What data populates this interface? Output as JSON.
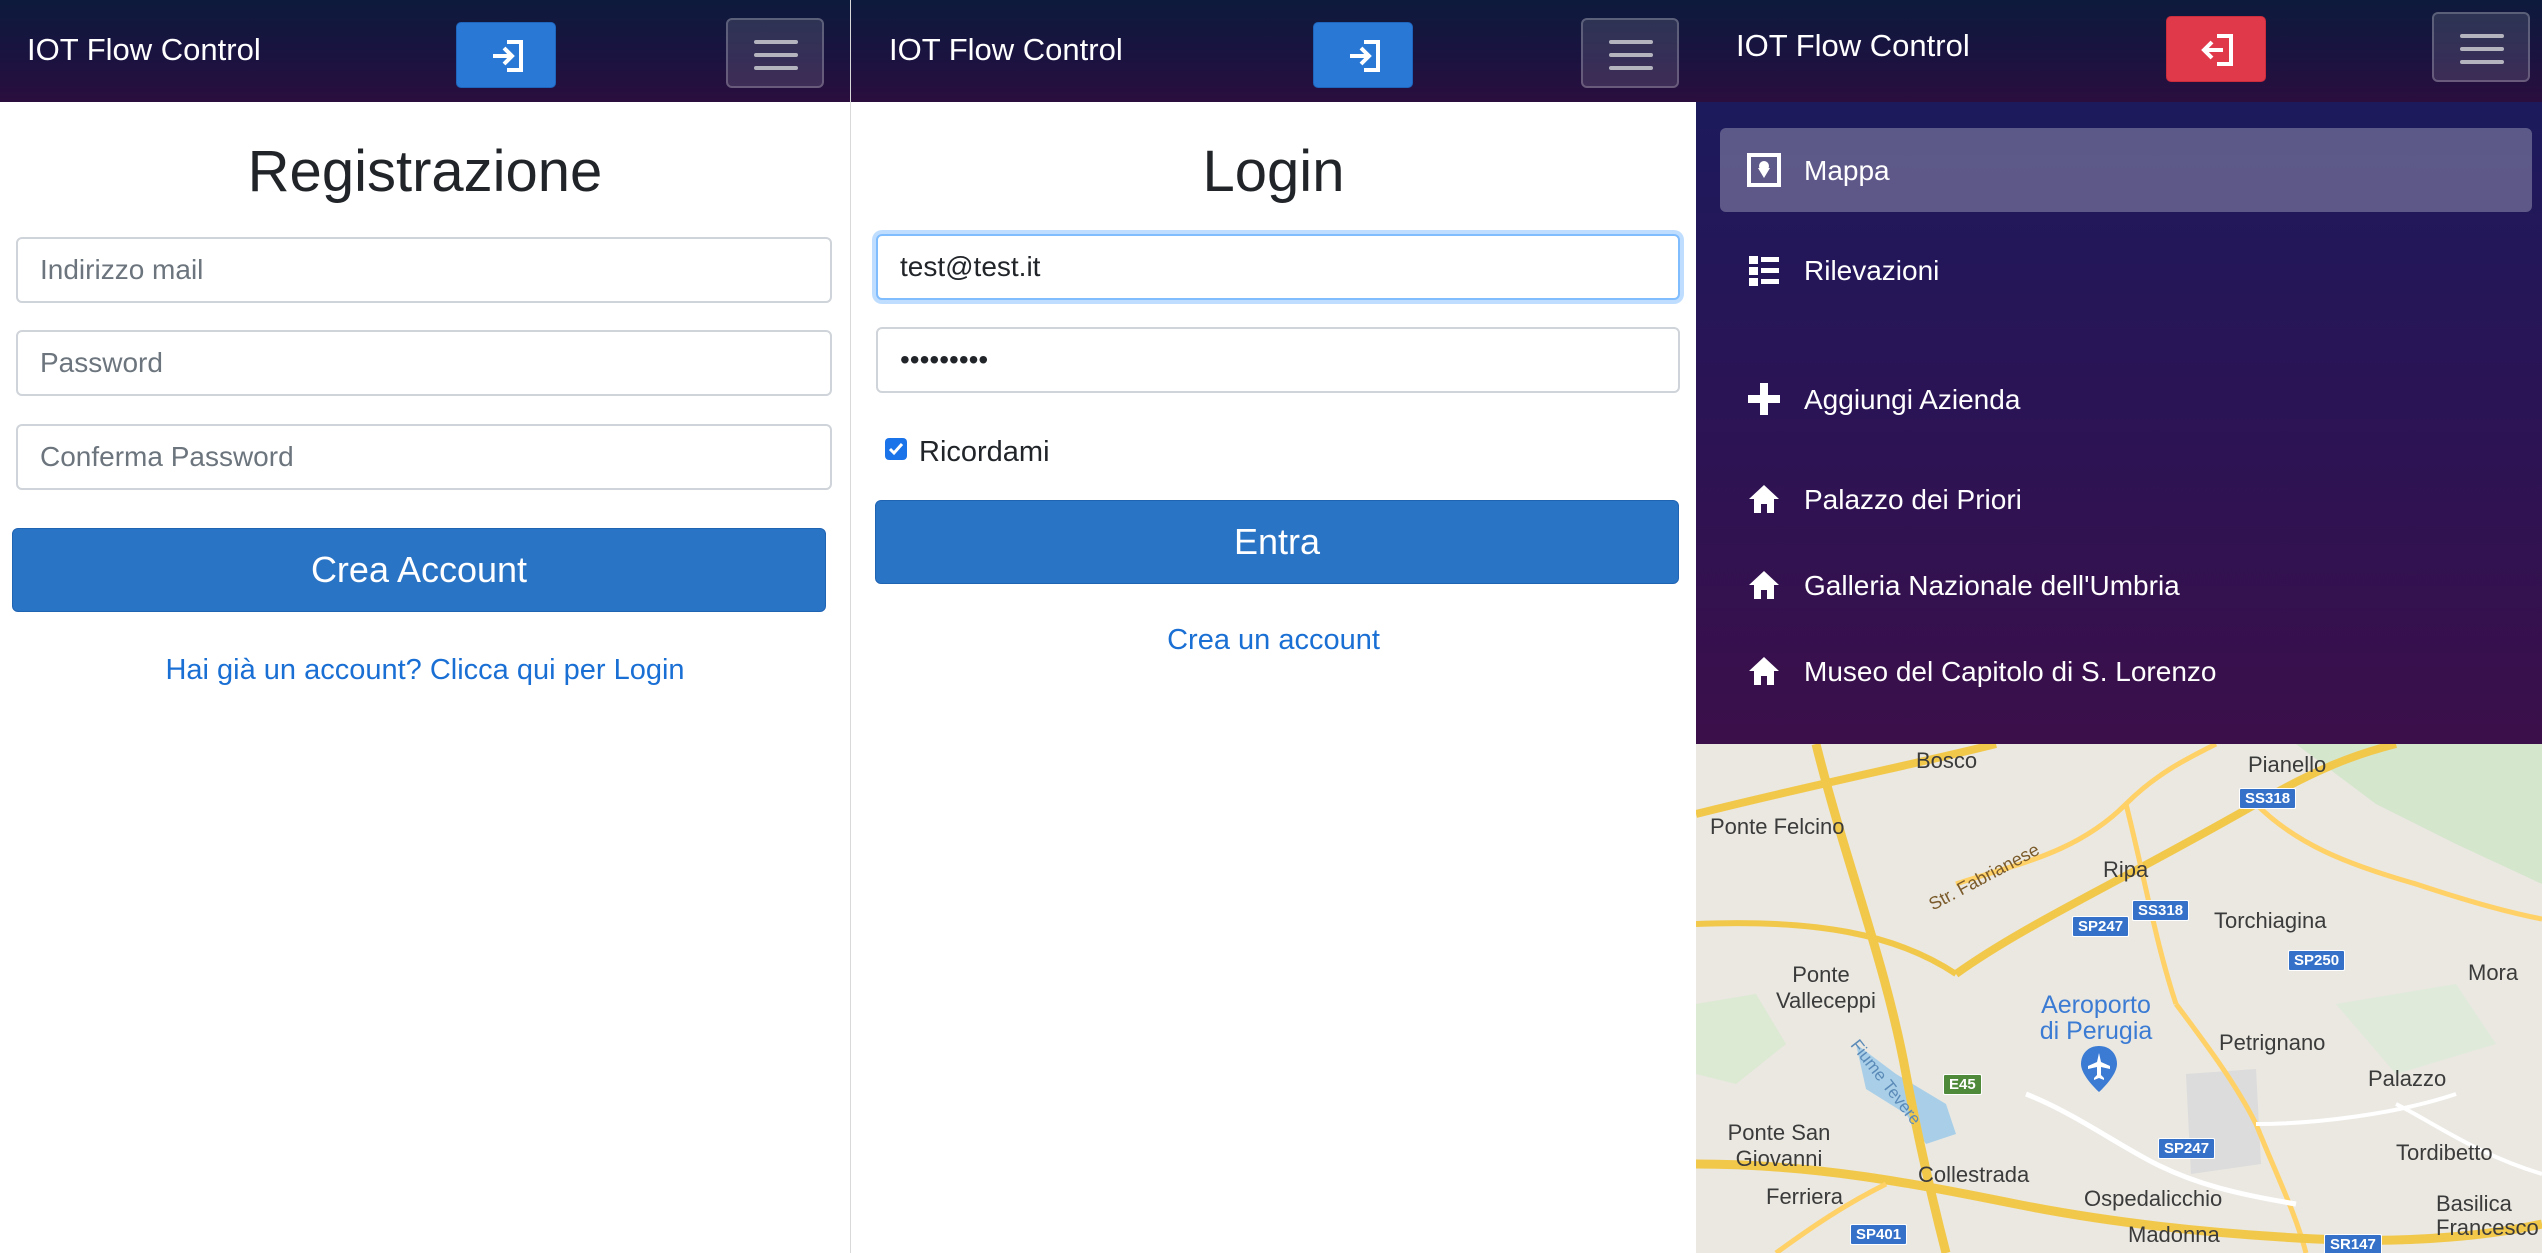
{
  "app": {
    "brand": "IOT Flow Control"
  },
  "colors": {
    "primary": "#2a74c6",
    "danger": "#e03a4a",
    "navbar": "#1a1340",
    "link": "#1a6fd4",
    "map_water": "#a9cfe8"
  },
  "registration": {
    "title": "Registrazione",
    "email_placeholder": "Indirizzo mail",
    "password_placeholder": "Password",
    "confirm_placeholder": "Conferma Password",
    "submit_label": "Crea Account",
    "login_link": "Hai già un account? Clicca qui per Login"
  },
  "login": {
    "title": "Login",
    "email_value": "test@test.it",
    "password_value": "123456789",
    "remember_label": "Ricordami",
    "remember_checked": true,
    "submit_label": "Entra",
    "register_link": "Crea un account"
  },
  "menu": {
    "items": [
      {
        "label": "Mappa",
        "icon": "map-icon",
        "active": true
      },
      {
        "label": "Rilevazioni",
        "icon": "list-icon",
        "active": false
      },
      {
        "label": "Aggiungi Azienda",
        "icon": "plus-icon",
        "active": false
      },
      {
        "label": "Palazzo dei Priori",
        "icon": "home-icon",
        "active": false
      },
      {
        "label": "Galleria Nazionale dell'Umbria",
        "icon": "home-icon",
        "active": false
      },
      {
        "label": "Museo del Capitolo di S. Lorenzo",
        "icon": "home-icon",
        "active": false
      }
    ]
  },
  "map": {
    "places": {
      "bosco": "Bosco",
      "pianello": "Pianello",
      "ponte_felcino": "Ponte Felcino",
      "ripa": "Ripa",
      "str_fabrianese": "Str. Fabrianese",
      "torchiagina": "Torchiagina",
      "ponte_valleceppi_1": "Ponte",
      "ponte_valleceppi_2": "Valleceppi",
      "aeroporto_1": "Aeroporto",
      "aeroporto_2": "di Perugia",
      "mora": "Mora",
      "petrignano": "Petrignano",
      "fiume_tevere": "Fiume Tevere",
      "palazzo": "Palazzo",
      "ponte_san_giovanni_1": "Ponte San",
      "ponte_san_giovanni_2": "Giovanni",
      "tordibetto": "Tordibetto",
      "collestrada": "Collestrada",
      "ferriera": "Ferriera",
      "ospedalicchio": "Ospedalicchio",
      "basilica_1": "Basilica",
      "basilica_2": "Francesco d",
      "madonna": "Madonna"
    },
    "roads": {
      "ss318_a": "SS318",
      "ss318_b": "SS318",
      "sp247_a": "SP247",
      "sp247_b": "SP247",
      "sp250": "SP250",
      "e45": "E45",
      "sp401": "SP401",
      "sr147": "SR147"
    }
  }
}
